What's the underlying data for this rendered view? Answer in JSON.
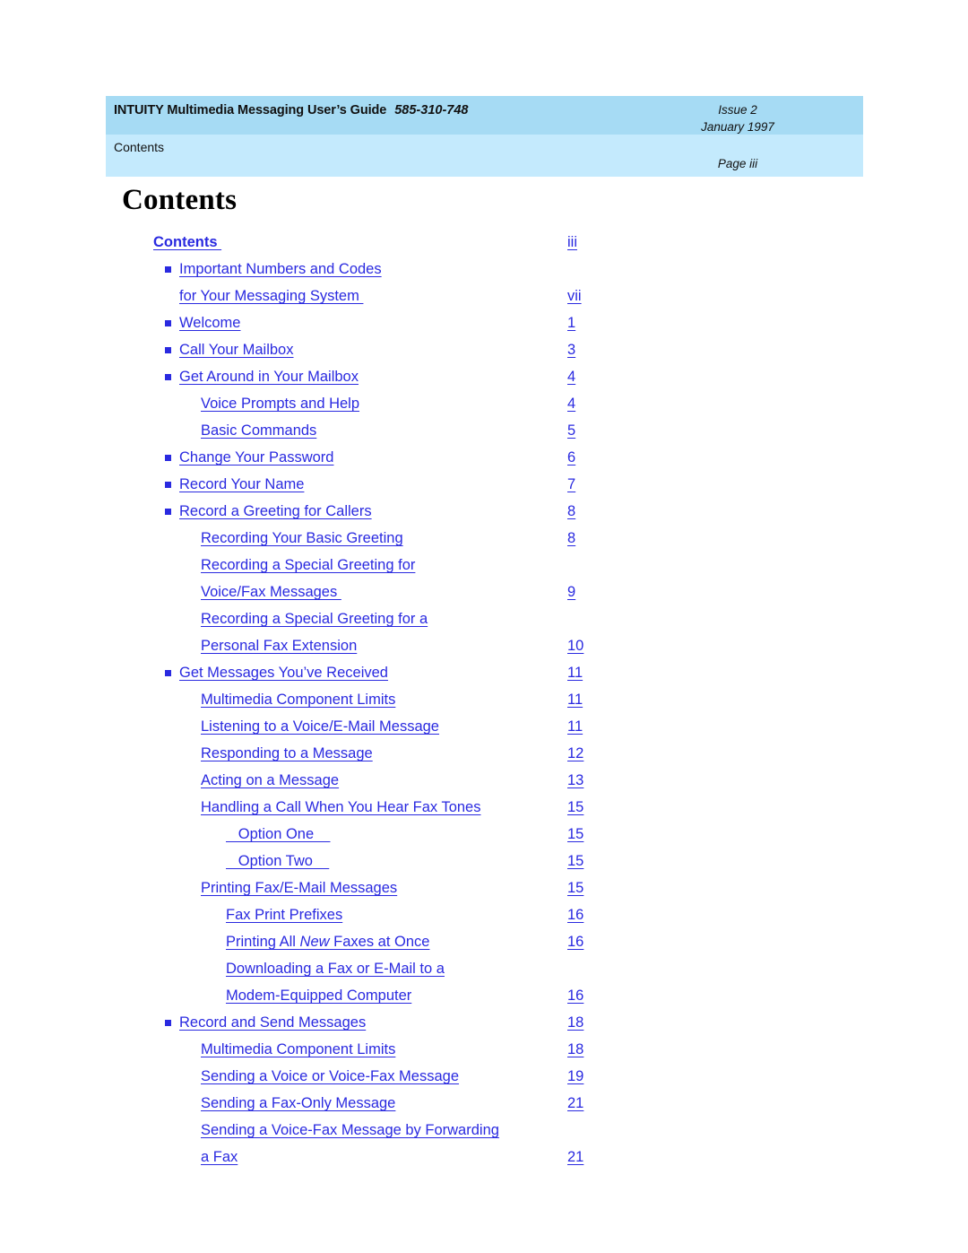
{
  "header": {
    "doc_title": "INTUITY Multimedia Messaging User’s Guide",
    "doc_number": "585-310-748",
    "issue": "Issue 2",
    "date": "January 1997",
    "section": "Contents",
    "page_label": "Page iii",
    "band_top_color": "#a6dbf4",
    "band_bottom_color": "#c4eafd"
  },
  "page_title": "Contents",
  "link_color": "#2a2ae0",
  "toc": {
    "entries": [
      {
        "level": 0,
        "bullet": false,
        "lines": [
          "Contents "
        ],
        "page": "iii"
      },
      {
        "level": 1,
        "bullet": true,
        "lines": [
          "Important Numbers and Codes",
          "for Your Messaging System "
        ],
        "page": "vii"
      },
      {
        "level": 1,
        "bullet": true,
        "lines": [
          "Welcome"
        ],
        "page": "1"
      },
      {
        "level": 1,
        "bullet": true,
        "lines": [
          "Call Your Mailbox"
        ],
        "page": "3"
      },
      {
        "level": 1,
        "bullet": true,
        "lines": [
          "Get Around in Your Mailbox"
        ],
        "page": "4"
      },
      {
        "level": 2,
        "bullet": false,
        "lines": [
          "Voice Prompts and Help"
        ],
        "page": "4"
      },
      {
        "level": 2,
        "bullet": false,
        "lines": [
          "Basic Commands"
        ],
        "page": "5"
      },
      {
        "level": 1,
        "bullet": true,
        "lines": [
          "Change Your Password"
        ],
        "page": "6"
      },
      {
        "level": 1,
        "bullet": true,
        "lines": [
          "Record Your Name"
        ],
        "page": "7"
      },
      {
        "level": 1,
        "bullet": true,
        "lines": [
          "Record a Greeting for Callers"
        ],
        "page": "8"
      },
      {
        "level": 2,
        "bullet": false,
        "lines": [
          "Recording Your Basic Greeting"
        ],
        "page": "8"
      },
      {
        "level": 2,
        "bullet": false,
        "lines": [
          "Recording a Special Greeting for",
          "Voice/Fax Messages "
        ],
        "page": "9"
      },
      {
        "level": 2,
        "bullet": false,
        "lines": [
          "Recording a Special Greeting for a",
          "Personal Fax Extension"
        ],
        "page": "10"
      },
      {
        "level": 1,
        "bullet": true,
        "lines": [
          "Get Messages You’ve Received"
        ],
        "page": "11"
      },
      {
        "level": 2,
        "bullet": false,
        "lines": [
          "Multimedia Component Limits"
        ],
        "page": "11"
      },
      {
        "level": 2,
        "bullet": false,
        "lines": [
          "Listening to a Voice/E-Mail Message"
        ],
        "page": "11"
      },
      {
        "level": 2,
        "bullet": false,
        "lines": [
          "Responding to a Message"
        ],
        "page": "12"
      },
      {
        "level": 2,
        "bullet": false,
        "lines": [
          "Acting on a Message"
        ],
        "page": "13"
      },
      {
        "level": 2,
        "bullet": false,
        "lines": [
          "Handling a Call When You Hear Fax Tones"
        ],
        "page": "15"
      },
      {
        "level": 3,
        "bullet": false,
        "lines": [
          "   Option One    "
        ],
        "page": "15"
      },
      {
        "level": 3,
        "bullet": false,
        "lines": [
          "   Option Two    "
        ],
        "page": "15"
      },
      {
        "level": 2,
        "bullet": false,
        "lines": [
          "Printing Fax/E-Mail Messages"
        ],
        "page": "15"
      },
      {
        "level": 3,
        "bullet": false,
        "lines": [
          "Fax Print Prefixes"
        ],
        "page": "16"
      },
      {
        "level": 3,
        "bullet": false,
        "lines": [
          "Printing All ",
          "New",
          " Faxes at Once"
        ],
        "italic_line_index": 1,
        "single_line_rich": true,
        "page": "16"
      },
      {
        "level": 3,
        "bullet": false,
        "lines": [
          "Downloading a Fax or E-Mail to a",
          "Modem-Equipped Computer"
        ],
        "page": "16"
      },
      {
        "level": 1,
        "bullet": true,
        "lines": [
          "Record and Send Messages"
        ],
        "page": "18"
      },
      {
        "level": 2,
        "bullet": false,
        "lines": [
          "Multimedia Component Limits"
        ],
        "page": "18"
      },
      {
        "level": 2,
        "bullet": false,
        "lines": [
          "Sending a Voice or Voice-Fax Message"
        ],
        "page": "19"
      },
      {
        "level": 2,
        "bullet": false,
        "lines": [
          "Sending a Fax-Only Message"
        ],
        "page": "21"
      },
      {
        "level": 2,
        "bullet": false,
        "lines": [
          "Sending a Voice-Fax Message by Forwarding",
          "a Fax"
        ],
        "page": "21"
      }
    ]
  }
}
